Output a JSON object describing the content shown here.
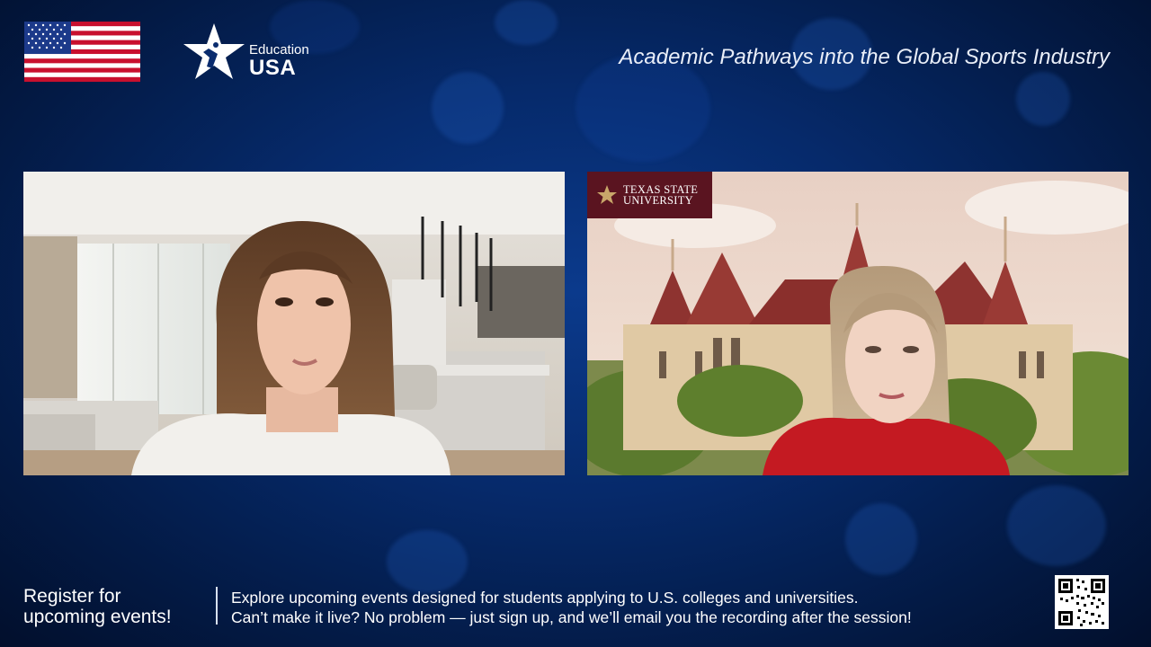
{
  "header": {
    "logo_text_top": "Education",
    "logo_text_bottom": "USA",
    "event_title": "Academic Pathways into the Global Sports Industry"
  },
  "video_tiles": [
    {
      "name": "speaker-1"
    },
    {
      "name": "speaker-2",
      "badge_line1": "TEXAS STATE",
      "badge_line2": "UNIVERSITY"
    }
  ],
  "footer": {
    "register_line1": "Register for",
    "register_line2": "upcoming events!",
    "info_line1": "Explore upcoming events designed for students applying to U.S. colleges and universities.",
    "info_line2": "Can’t make it live? No problem — just sign up, and we’ll email you the recording after the session!"
  },
  "colors": {
    "background": "#062a6b",
    "texas_state_maroon": "#5a1420",
    "flag_red": "#c8102e",
    "flag_blue": "#1c3a8a"
  },
  "icons": [
    "us-flag-icon",
    "education-usa-star-icon",
    "texas-state-star-icon",
    "qr-code-icon"
  ]
}
